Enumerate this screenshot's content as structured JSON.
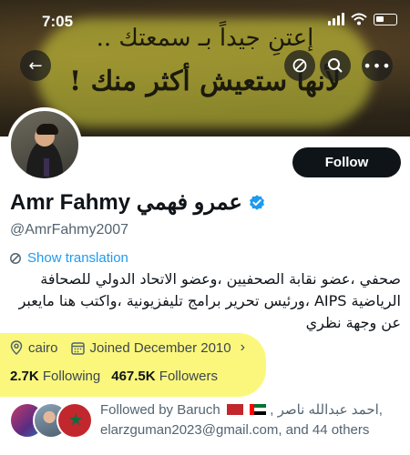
{
  "status_bar": {
    "time": "7:05"
  },
  "banner": {
    "quote_line1": "إعتنِ جيداً بـ سمعتك ..",
    "quote_line2": "لأنها ستعيش أكثر منك !",
    "highlight_color": "#d6d63c"
  },
  "header_actions": {
    "back_icon": "arrow-left-icon",
    "quote_icon": "no-entry-icon",
    "search_icon": "search-icon",
    "more_icon": "more-horizontal-icon"
  },
  "profile": {
    "display_name": "Amr Fahmy عمرو فهمي",
    "handle": "@AmrFahmy2007",
    "verified": true,
    "verified_color": "#1d9bf0",
    "follow_label": "Follow",
    "show_translation": "Show translation",
    "bio": "صحفي ،عضو نقابة الصحفيين ،وعضو الاتحاد الدولي للصحافة الرياضية AIPS ،ورئيس تحرير برامج تليفزيونية ،واكتب هنا مايعبر عن وجهة نظري",
    "location": "cairo",
    "joined": "Joined December 2010",
    "following_count": "2.7K",
    "following_label": "Following",
    "followers_count": "467.5K",
    "followers_label": "Followers",
    "followed_by_prefix": "Followed by Baruch",
    "followed_by_rest": ", احمد عبدالله ناصر,",
    "followed_by_line2": "elarzguman2023@gmail.com, and 44 others"
  },
  "colors": {
    "accent": "#1d9bf0",
    "highlight": "#fbf66f",
    "text_primary": "#0f1419",
    "text_secondary": "#536471"
  }
}
